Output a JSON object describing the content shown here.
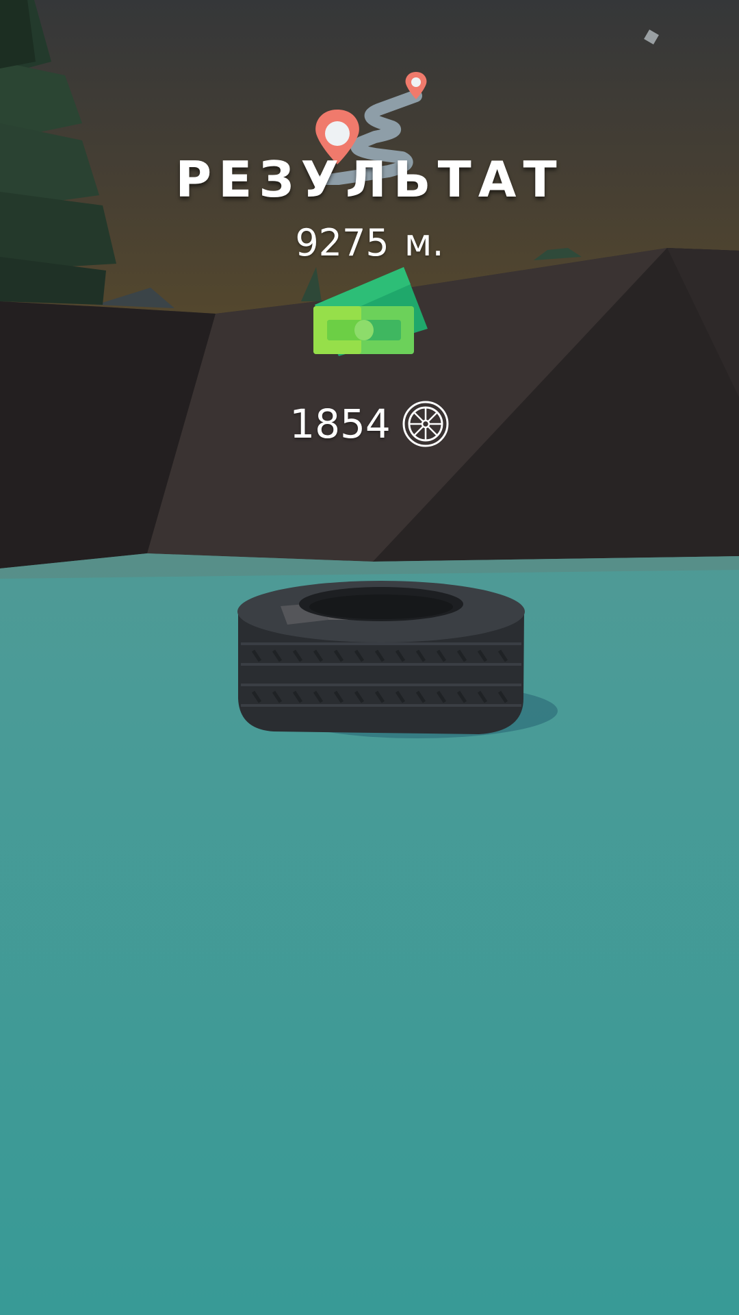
{
  "result": {
    "title": "РЕЗУЛЬТАТ",
    "distance_value": "9275",
    "distance_unit": "м.",
    "coins_value": "1854"
  },
  "icons": {
    "route": "map-route-icon",
    "cash": "cash-icon",
    "wheel": "wheel-coin-icon"
  },
  "colors": {
    "sky_top": "#353739",
    "sky_horizon": "#4e442e",
    "rock": "#2f2b2b",
    "ground": "#3a9a96",
    "pin": "#f07a6c",
    "cash_green": "#5dcc55"
  }
}
